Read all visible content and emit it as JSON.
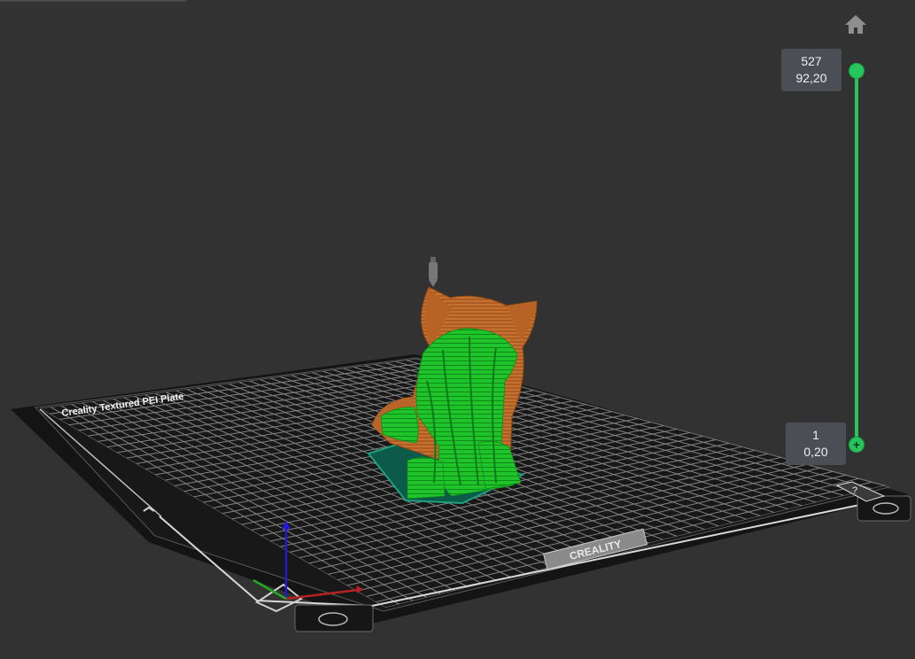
{
  "viewport": {
    "plate_label": "Creality Textured PEI Plate",
    "brand_label": "CREALITY",
    "help_label": "?",
    "colors": {
      "background": "#323232",
      "plate": "#141414",
      "grid": "#8e8e8e",
      "model_wall": "#c8702e",
      "model_support": "#1fc42a",
      "model_base": "#0b5a4a",
      "slider_accent": "#27c65c"
    }
  },
  "toolbar": {
    "home_icon": "home-icon"
  },
  "layer_slider": {
    "top": {
      "layer": "527",
      "height": "92,20"
    },
    "bottom": {
      "layer": "1",
      "height": "0,20",
      "handle_symbol": "+"
    }
  }
}
